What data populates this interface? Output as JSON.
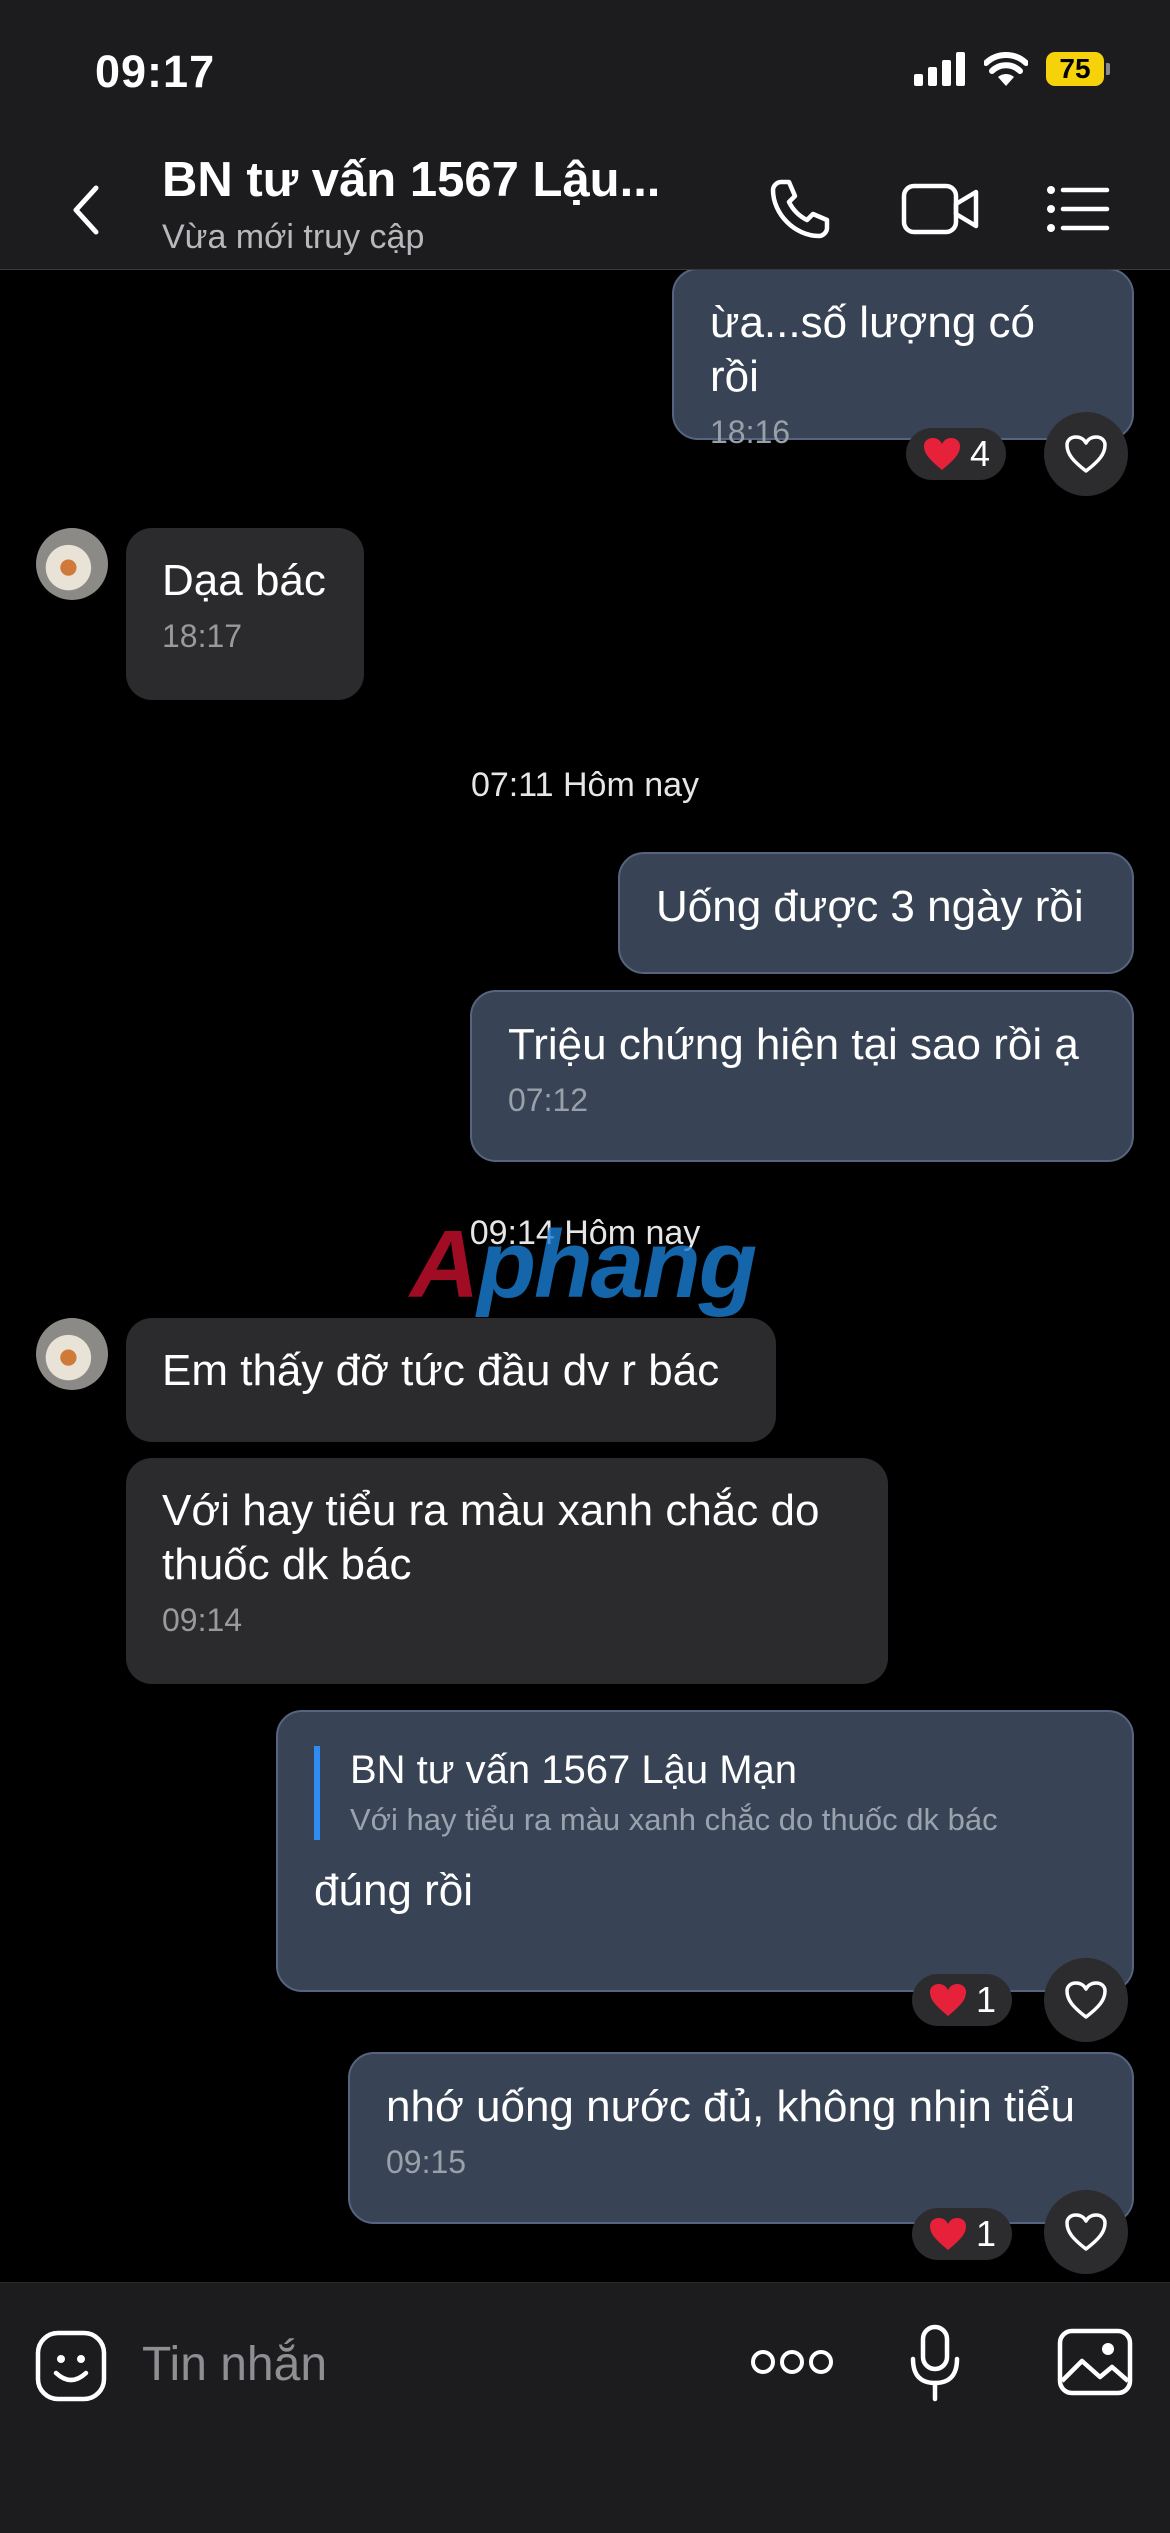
{
  "status_bar": {
    "time": "09:17",
    "battery": "75",
    "icons": [
      "signal-icon",
      "wifi-icon",
      "battery-icon"
    ]
  },
  "header": {
    "title": "BN tư vấn 1567 Lậu...",
    "subtitle": "Vừa mới truy cập",
    "icons": [
      "back-icon",
      "phone-icon",
      "video-call-icon",
      "menu-icon"
    ]
  },
  "messages": [
    {
      "dir": "out",
      "text": "ừa...số lượng có rồi",
      "time": "18:16",
      "reaction_count": "4"
    },
    {
      "dir": "in",
      "text": "Dạa bác",
      "time": "18:17"
    },
    {
      "type": "separator",
      "text": "07:11 Hôm nay"
    },
    {
      "dir": "out",
      "text": "Uống được 3 ngày rồi"
    },
    {
      "dir": "out",
      "text": "Triệu chứng hiện tại sao rồi ạ",
      "time": "07:12"
    },
    {
      "type": "separator",
      "text": "09:14 Hôm nay"
    },
    {
      "dir": "in",
      "text": "Em thấy đỡ tức đầu dv r bác"
    },
    {
      "dir": "in",
      "text": "Với hay tiểu ra màu xanh chắc do thuốc dk bác",
      "time": "09:14"
    },
    {
      "dir": "out",
      "quote_name": "BN tư vấn 1567 Lậu Mạn",
      "quote_text": "Với hay tiểu ra màu xanh chắc do thuốc dk bác",
      "text": "đúng rồi",
      "reaction_count": "1"
    },
    {
      "dir": "out",
      "text": "nhớ uống nước đủ, không nhịn tiểu",
      "time": "09:15",
      "reaction_count": "1"
    }
  ],
  "watermark": {
    "part_a": "A",
    "part_b": "phang"
  },
  "input": {
    "placeholder": "Tin nhắn",
    "icons": [
      "sticker-icon",
      "more-icon",
      "microphone-icon",
      "image-icon"
    ]
  },
  "colors": {
    "outgoing_bubble": "#384455",
    "incoming_bubble": "#2b2b2d",
    "reaction_heart": "#e8213a",
    "quote_bar": "#2f8cf2",
    "battery": "#f5d20a"
  }
}
